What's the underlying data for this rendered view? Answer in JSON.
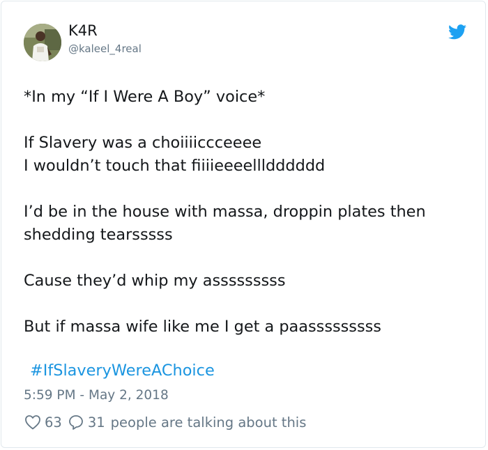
{
  "user": {
    "name": "K4R",
    "handle": "@kaleel_4real",
    "avatar_icon": "avatar-photo"
  },
  "tweet": {
    "lines": [
      "*In my “If I Were A Boy” voice*",
      "",
      "If Slavery was a choiiiiccceeee",
      "I wouldn’t touch that fiiiieeeellldddddd",
      "",
      "I’d be in the house with massa, droppin plates then",
      "shedding tearsssss",
      "",
      "Cause they’d whip my asssssssss",
      "",
      "But if massa wife like me I get a paasssssssss"
    ],
    "hashtag": "#IfSlaveryWereAChoice",
    "timestamp": "5:59 PM - May 2, 2018"
  },
  "actions": {
    "like_count": "63",
    "reply_count": "31",
    "talking_text": "people are talking about this"
  },
  "colors": {
    "twitter_blue": "#1da1f2",
    "link_blue": "#1b95e0",
    "secondary_text": "#657786"
  }
}
